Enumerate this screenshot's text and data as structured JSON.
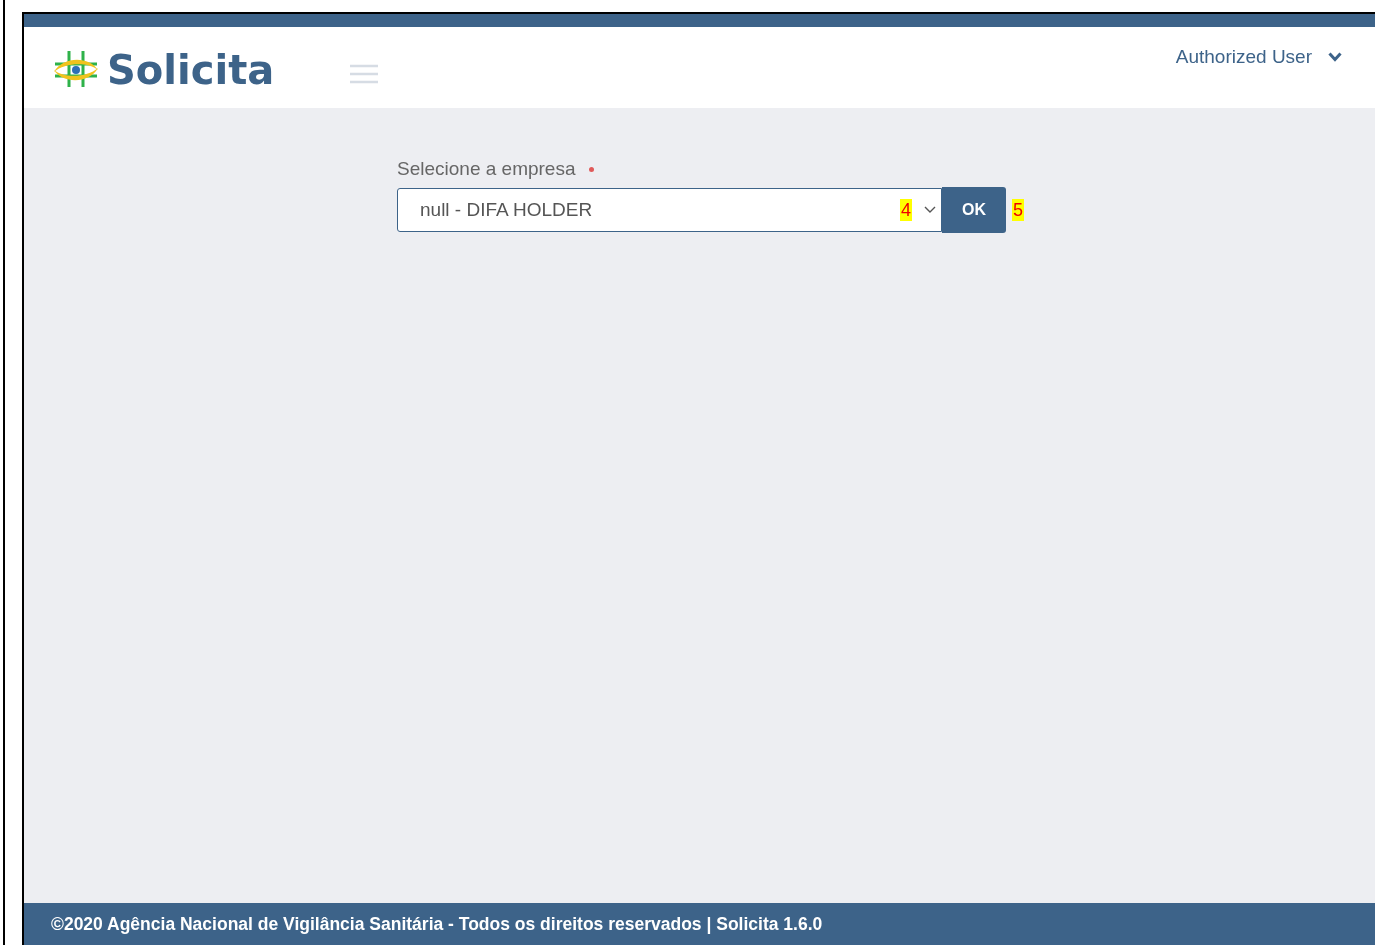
{
  "header": {
    "brand": "Solicita",
    "user_menu": "Authorized User"
  },
  "form": {
    "label": "Selecione a empresa",
    "required": true,
    "select_value": "null - DIFA HOLDER",
    "button": "OK"
  },
  "annotations": [
    {
      "text": "4"
    },
    {
      "text": "5"
    }
  ],
  "footer": {
    "text": "©2020 Agência Nacional de Vigilância Sanitária - Todos os direitos reservados | Solicita 1.6.0"
  }
}
